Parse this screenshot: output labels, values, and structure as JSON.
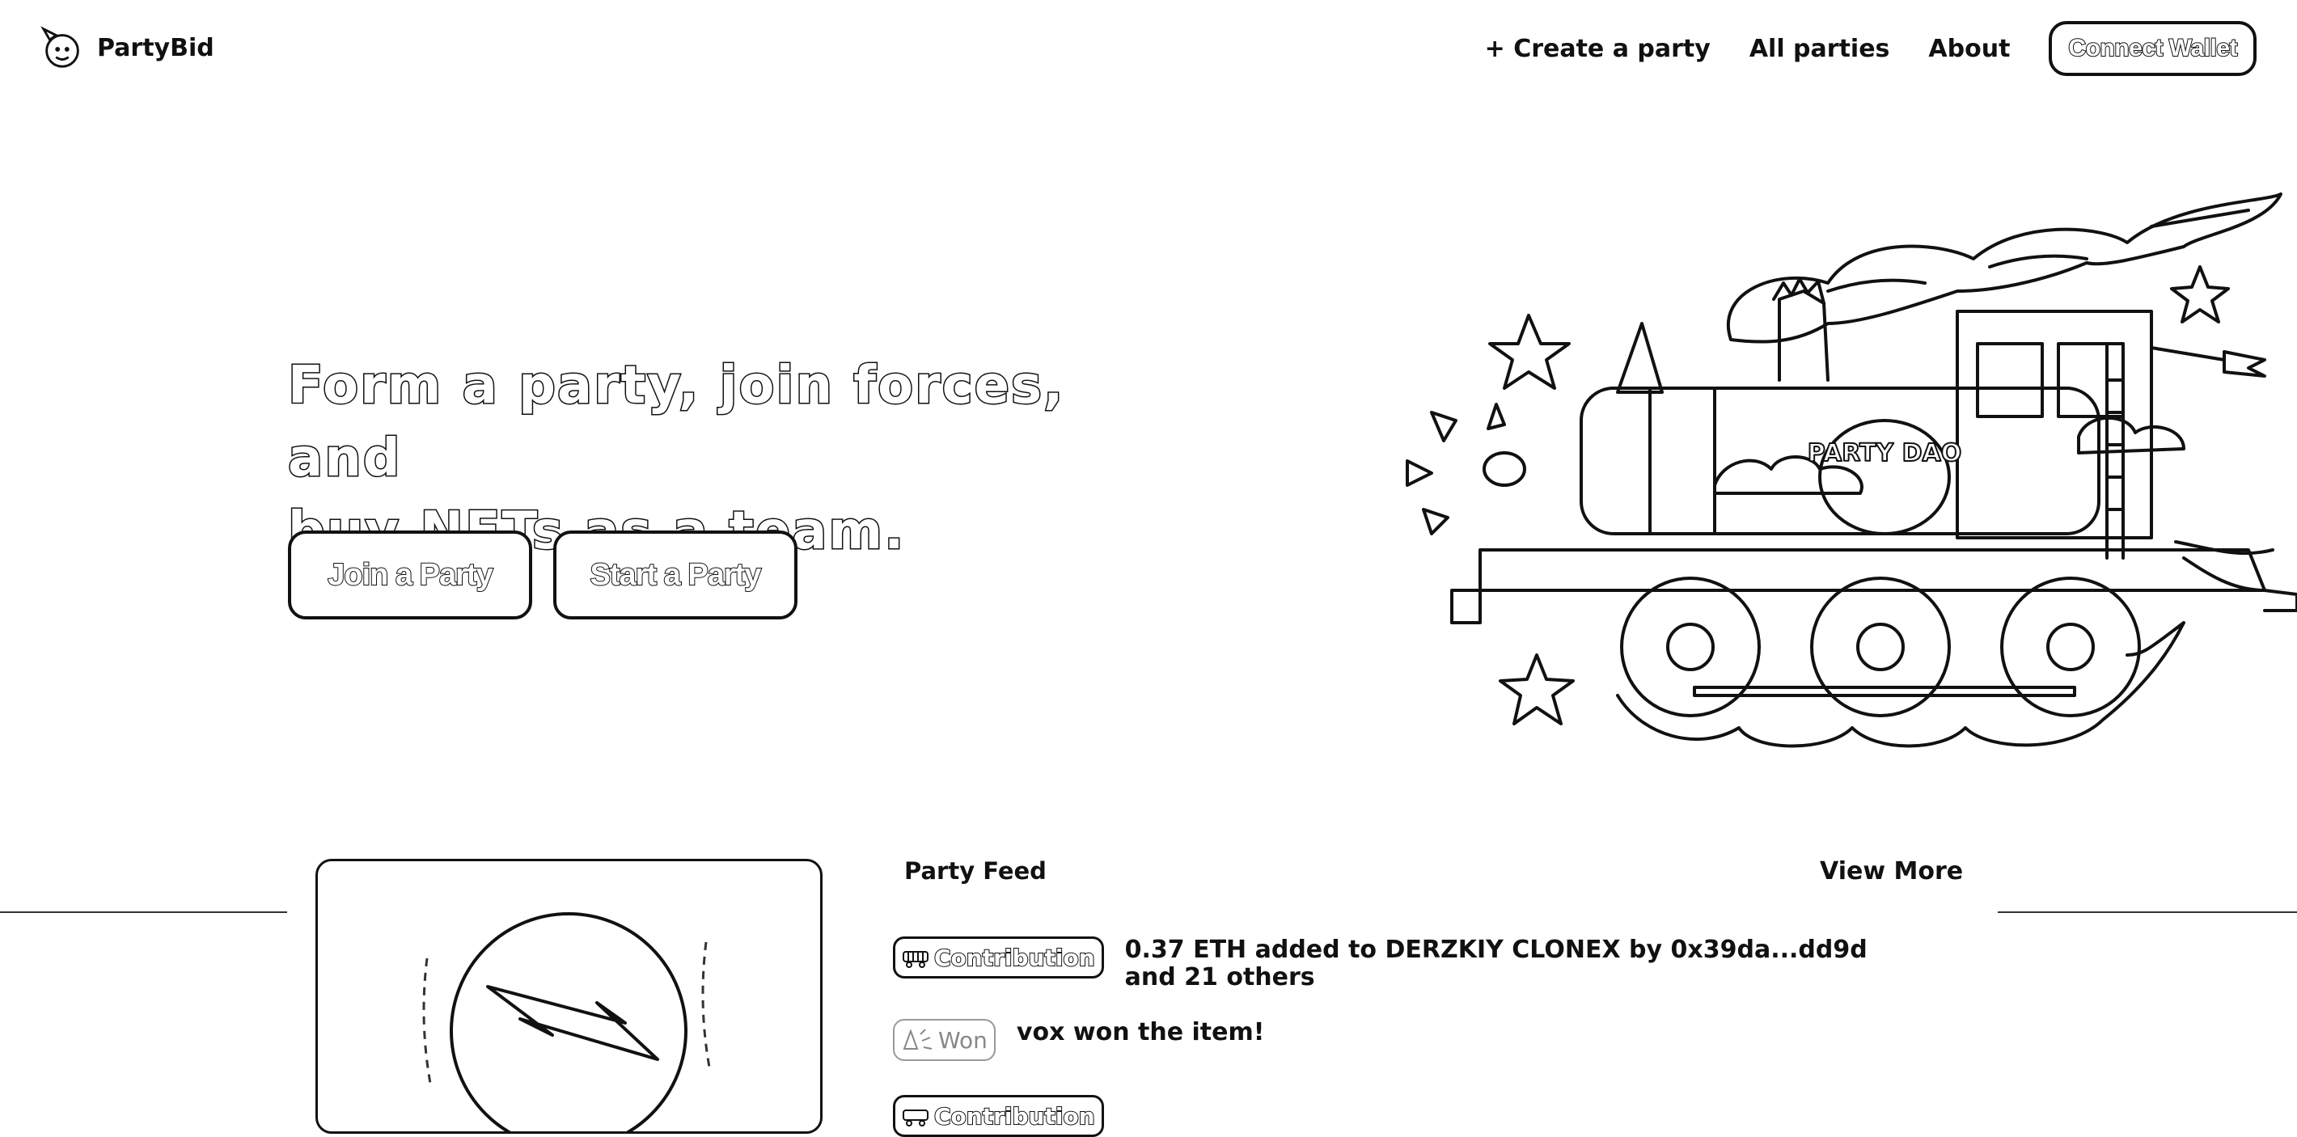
{
  "brand": {
    "name": "PartyBid",
    "logo_icon": "party-animal-logo-icon"
  },
  "nav": {
    "create_party": "+ Create a party",
    "all_parties": "All parties",
    "about": "About",
    "connect_wallet": "Connect Wallet"
  },
  "hero": {
    "title_line1": "Form a party, join forces, and",
    "title_line2": "buy NFTs as a team.",
    "join_button": "Join a Party",
    "start_button": "Start a Party",
    "illustration": "party-train-illustration",
    "train_sign": "PARTY DAO"
  },
  "feed": {
    "title": "Party Feed",
    "view_more": "View More",
    "items": [
      {
        "badge": "Contribution",
        "badge_icon": "train-icon",
        "text": "0.37 ETH added to DERZKIY CLONEX by 0x39da...dd9d and 21 others"
      },
      {
        "badge": "Won",
        "badge_icon": "confetti-icon",
        "text": "vox won the item!"
      },
      {
        "badge": "Contribution",
        "badge_icon": "train-icon",
        "text": ""
      }
    ]
  },
  "featured_card": {
    "image": "lightning-bolt-nft-image"
  },
  "colors": {
    "ink": "#111111",
    "background": "#ffffff"
  }
}
